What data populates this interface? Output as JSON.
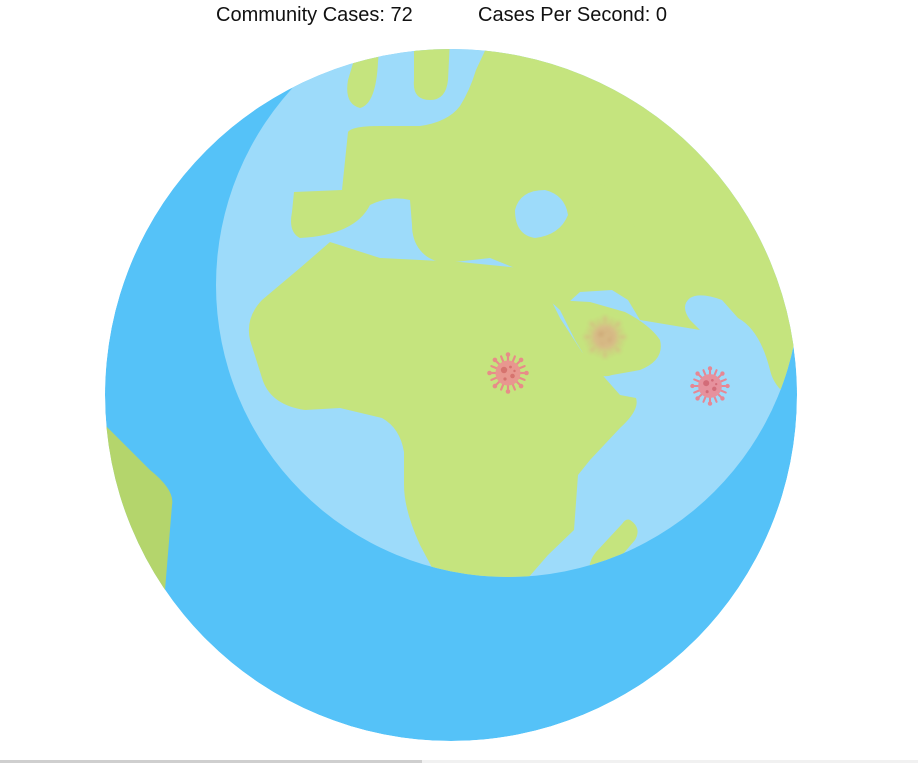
{
  "stats": {
    "community_cases_label": "Community Cases: 72",
    "cases_per_second_label": "Cases Per Second: 0"
  },
  "colors": {
    "ocean_dark": "#55c2f8",
    "ocean_light": "#9ddbfa",
    "land": "#c5e47e",
    "land_shadow": "#b4d56c",
    "virus": "#ee7f8a"
  },
  "viruses": [
    {
      "name": "virus-central-africa",
      "icon": "virus-icon",
      "opacity": 0.85,
      "blurred": false
    },
    {
      "name": "virus-arabia",
      "icon": "virus-icon",
      "opacity": 0.45,
      "blurred": true
    },
    {
      "name": "virus-indian-ocean",
      "icon": "virus-icon",
      "opacity": 0.9,
      "blurred": false
    }
  ],
  "progress": {
    "fraction": 0.46
  }
}
